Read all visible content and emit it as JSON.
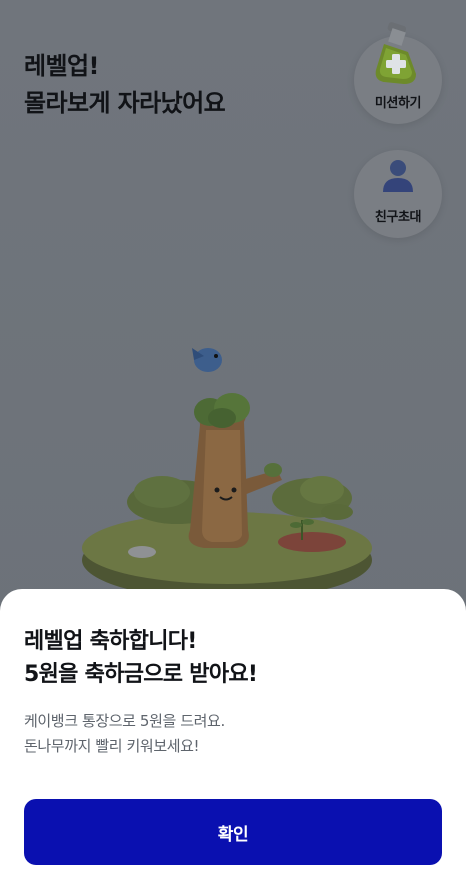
{
  "header": {
    "line1": "레벨업!",
    "line2": "몰라보게 자라났어요"
  },
  "floating_buttons": {
    "mission": {
      "label": "미션하기",
      "icon": "flask-plus-icon"
    },
    "invite": {
      "label": "친구초대",
      "icon": "person-icon"
    }
  },
  "scene": {
    "description_icon": "tree-stump-island-illustration"
  },
  "sheet": {
    "title_line1": "레벨업 축하합니다!",
    "title_line2": "5원을 축하금으로 받아요!",
    "desc_line1": "케이뱅크 통장으로 5원을 드려요.",
    "desc_line2": "돈나무까지 빨리 키워보세요!",
    "confirm_label": "확인"
  },
  "colors": {
    "overlay_bg": "#6f747b",
    "primary_button": "#0a10b0",
    "sheet_bg": "#ffffff",
    "title_text": "#111317",
    "desc_text": "#5e646c"
  }
}
